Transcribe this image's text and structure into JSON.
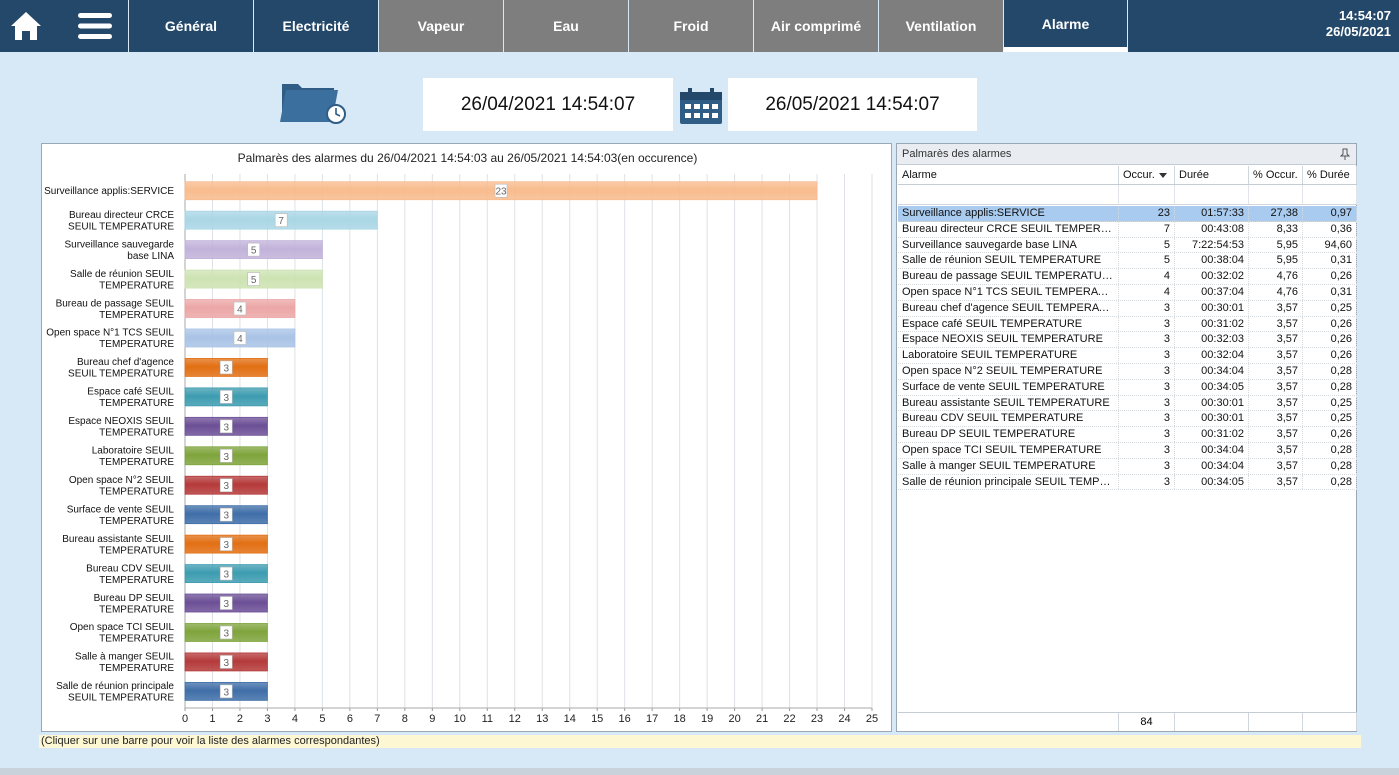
{
  "nav": {
    "home_icon": "home-icon",
    "menu_icon": "hamburger-icon",
    "tabs": [
      {
        "label": "Général",
        "style": "dark"
      },
      {
        "label": "Electricité",
        "style": "dark"
      },
      {
        "label": "Vapeur",
        "style": "gray"
      },
      {
        "label": "Eau",
        "style": "gray"
      },
      {
        "label": "Froid",
        "style": "gray"
      },
      {
        "label": "Air comprimé",
        "style": "gray"
      },
      {
        "label": "Ventilation",
        "style": "gray"
      },
      {
        "label": "Alarme",
        "style": "active"
      }
    ],
    "time": "14:54:07",
    "date": "26/05/2021"
  },
  "period": {
    "from": "26/04/2021 14:54:07",
    "to": "26/05/2021 14:54:07"
  },
  "chart_data": {
    "type": "bar",
    "orientation": "horizontal",
    "title": "Palmarès des alarmes du 26/04/2021 14:54:03 au 26/05/2021 14:54:03(en occurence)",
    "categories": [
      "Surveillance applis:SERVICE",
      "Bureau directeur CRCE SEUIL TEMPERATURE",
      "Surveillance sauvegarde base LINA",
      "Salle de réunion SEUIL TEMPERATURE",
      "Bureau de passage SEUIL TEMPERATURE",
      "Open space N°1 TCS SEUIL TEMPERATURE",
      "Bureau chef d'agence SEUIL TEMPERATURE",
      "Espace café SEUIL TEMPERATURE",
      "Espace NEOXIS SEUIL TEMPERATURE",
      "Laboratoire SEUIL TEMPERATURE",
      "Open space N°2 SEUIL TEMPERATURE",
      "Surface de vente SEUIL TEMPERATURE",
      "Bureau assistante SEUIL TEMPERATURE",
      "Bureau CDV SEUIL TEMPERATURE",
      "Bureau DP SEUIL TEMPERATURE",
      "Open space TCI SEUIL TEMPERATURE",
      "Salle à manger SEUIL TEMPERATURE",
      "Salle de réunion principale SEUIL TEMPERATURE"
    ],
    "labels_display": [
      [
        "Surveillance applis:SERVICE"
      ],
      [
        "Bureau directeur CRCE",
        "SEUIL TEMPERATURE"
      ],
      [
        "Surveillance sauvegarde",
        "base LINA"
      ],
      [
        "Salle de réunion SEUIL",
        "TEMPERATURE"
      ],
      [
        "Bureau de passage SEUIL",
        "TEMPERATURE"
      ],
      [
        "Open space N°1 TCS SEUIL",
        "TEMPERATURE"
      ],
      [
        "Bureau chef d'agence",
        "SEUIL TEMPERATURE"
      ],
      [
        "Espace café SEUIL",
        "TEMPERATURE"
      ],
      [
        "Espace NEOXIS SEUIL",
        "TEMPERATURE"
      ],
      [
        "Laboratoire SEUIL",
        "TEMPERATURE"
      ],
      [
        "Open space N°2 SEUIL",
        "TEMPERATURE"
      ],
      [
        "Surface de vente SEUIL",
        "TEMPERATURE"
      ],
      [
        "Bureau assistante SEUIL",
        "TEMPERATURE"
      ],
      [
        "Bureau CDV SEUIL",
        "TEMPERATURE"
      ],
      [
        "Bureau DP SEUIL",
        "TEMPERATURE"
      ],
      [
        "Open space TCI SEUIL",
        "TEMPERATURE"
      ],
      [
        "Salle à manger SEUIL",
        "TEMPERATURE"
      ],
      [
        "Salle de réunion principale",
        "SEUIL TEMPERATURE"
      ]
    ],
    "values": [
      23,
      7,
      5,
      5,
      4,
      4,
      3,
      3,
      3,
      3,
      3,
      3,
      3,
      3,
      3,
      3,
      3,
      3
    ],
    "colors": [
      "#f8bb8d",
      "#a9d6e5",
      "#c1b2da",
      "#cde3b2",
      "#eca6a6",
      "#a9c3e6",
      "#e26f13",
      "#3d9cb0",
      "#6c4f96",
      "#7fa43c",
      "#b53a3a",
      "#3f6ea8",
      "#e26f13",
      "#3d9cb0",
      "#6c4f96",
      "#7fa43c",
      "#b53a3a",
      "#3f6ea8"
    ],
    "xlim": [
      0,
      25
    ],
    "xticks": [
      0,
      1,
      2,
      3,
      4,
      5,
      6,
      7,
      8,
      9,
      10,
      11,
      12,
      13,
      14,
      15,
      16,
      17,
      18,
      19,
      20,
      21,
      22,
      23,
      24,
      25
    ],
    "grid": true
  },
  "table": {
    "caption": "Palmarès des alarmes",
    "columns": [
      "Alarme",
      "Occur.",
      "Durée",
      "% Occur.",
      "% Durée"
    ],
    "rows": [
      [
        "Surveillance applis:SERVICE",
        "23",
        "01:57:33",
        "27,38",
        "0,97"
      ],
      [
        "Bureau directeur CRCE SEUIL TEMPERATURE",
        "7",
        "00:43:08",
        "8,33",
        "0,36"
      ],
      [
        "Surveillance sauvegarde base LINA",
        "5",
        "7:22:54:53",
        "5,95",
        "94,60"
      ],
      [
        "Salle de réunion SEUIL TEMPERATURE",
        "5",
        "00:38:04",
        "5,95",
        "0,31"
      ],
      [
        "Bureau de passage SEUIL TEMPERATURE",
        "4",
        "00:32:02",
        "4,76",
        "0,26"
      ],
      [
        "Open space N°1 TCS SEUIL TEMPERATURE",
        "4",
        "00:37:04",
        "4,76",
        "0,31"
      ],
      [
        "Bureau chef d'agence SEUIL TEMPERATURE",
        "3",
        "00:30:01",
        "3,57",
        "0,25"
      ],
      [
        "Espace café SEUIL TEMPERATURE",
        "3",
        "00:31:02",
        "3,57",
        "0,26"
      ],
      [
        "Espace NEOXIS SEUIL TEMPERATURE",
        "3",
        "00:32:03",
        "3,57",
        "0,26"
      ],
      [
        "Laboratoire SEUIL TEMPERATURE",
        "3",
        "00:32:04",
        "3,57",
        "0,26"
      ],
      [
        "Open space N°2 SEUIL TEMPERATURE",
        "3",
        "00:34:04",
        "3,57",
        "0,28"
      ],
      [
        "Surface de vente SEUIL TEMPERATURE",
        "3",
        "00:34:05",
        "3,57",
        "0,28"
      ],
      [
        "Bureau assistante SEUIL TEMPERATURE",
        "3",
        "00:30:01",
        "3,57",
        "0,25"
      ],
      [
        "Bureau CDV SEUIL TEMPERATURE",
        "3",
        "00:30:01",
        "3,57",
        "0,25"
      ],
      [
        "Bureau DP SEUIL TEMPERATURE",
        "3",
        "00:31:02",
        "3,57",
        "0,26"
      ],
      [
        "Open space TCI SEUIL TEMPERATURE",
        "3",
        "00:34:04",
        "3,57",
        "0,28"
      ],
      [
        "Salle à manger SEUIL TEMPERATURE",
        "3",
        "00:34:04",
        "3,57",
        "0,28"
      ],
      [
        "Salle de réunion principale SEUIL TEMPERATURE",
        "3",
        "00:34:05",
        "3,57",
        "0,28"
      ]
    ],
    "total_occur": "84",
    "selected_row": 0
  },
  "hint": "(Cliquer sur une barre pour voir la liste des alarmes correspondantes)",
  "colors": {
    "nav_dark": "#24486a",
    "nav_gray": "#7e7e7e",
    "background": "#d7e9f7",
    "selected_row": "#a9cbef"
  }
}
